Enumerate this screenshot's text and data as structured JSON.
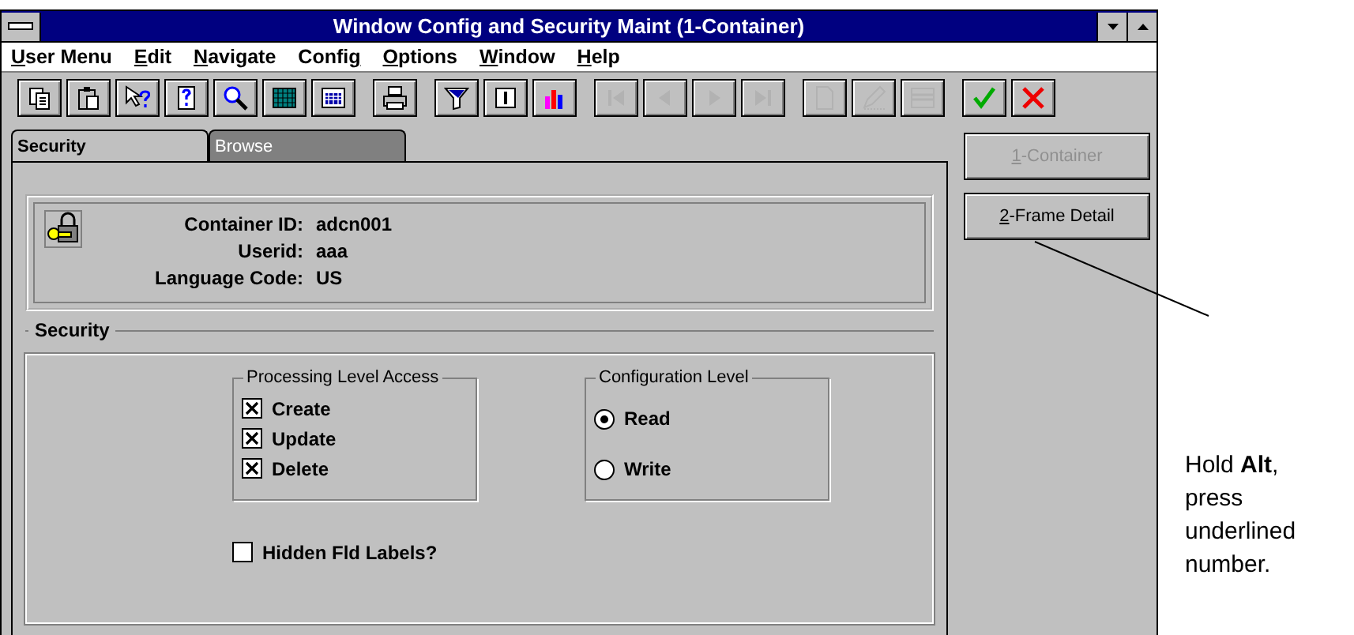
{
  "window": {
    "title": "Window Config and Security Maint (1-Container)"
  },
  "menu": [
    {
      "key": "U",
      "rest": "ser Menu"
    },
    {
      "key": "E",
      "rest": "dit"
    },
    {
      "key": "N",
      "rest": "avigate"
    },
    {
      "pre": "Confi",
      "key": "g"
    },
    {
      "key": "O",
      "rest": "ptions"
    },
    {
      "key": "W",
      "rest": "indow"
    },
    {
      "key": "H",
      "rest": "elp"
    }
  ],
  "toolbar": [
    [
      {
        "kind": "copy",
        "disabled": false
      },
      {
        "kind": "paste",
        "disabled": false
      },
      {
        "kind": "pointer-help",
        "disabled": false
      },
      {
        "kind": "help-book",
        "disabled": false
      },
      {
        "kind": "find",
        "disabled": false
      },
      {
        "kind": "grid",
        "disabled": false
      },
      {
        "kind": "calculator",
        "disabled": false
      }
    ],
    [
      {
        "kind": "print",
        "disabled": false
      }
    ],
    [
      {
        "kind": "filter",
        "disabled": false
      },
      {
        "kind": "text-cursor",
        "disabled": false
      },
      {
        "kind": "chart",
        "disabled": false
      }
    ],
    [
      {
        "kind": "first",
        "disabled": true
      },
      {
        "kind": "prev",
        "disabled": true
      },
      {
        "kind": "next",
        "disabled": true
      },
      {
        "kind": "last",
        "disabled": true
      }
    ],
    [
      {
        "kind": "new",
        "disabled": true
      },
      {
        "kind": "edit",
        "disabled": true
      },
      {
        "kind": "table",
        "disabled": true
      }
    ],
    [
      {
        "kind": "ok",
        "disabled": false
      },
      {
        "kind": "cancel",
        "disabled": false
      }
    ]
  ],
  "tabs": [
    {
      "label": "Security",
      "selected": true
    },
    {
      "label": "Browse",
      "selected": false
    }
  ],
  "info": [
    {
      "label": "Container ID:",
      "value": "adcn001"
    },
    {
      "label": "Userid:",
      "value": "aaa"
    },
    {
      "label": "Language Code:",
      "value": "US"
    }
  ],
  "security": {
    "title": "Security",
    "processing": {
      "title": "Processing Level Access",
      "items": [
        {
          "label": "Create",
          "checked": true
        },
        {
          "label": "Update",
          "checked": true
        },
        {
          "label": "Delete",
          "checked": true
        }
      ]
    },
    "configuration": {
      "title": "Configuration Level",
      "options": [
        {
          "label": "Read",
          "selected": true
        },
        {
          "label": "Write",
          "selected": false
        }
      ]
    },
    "hidden_labels": {
      "label": "Hidden Fld Labels?",
      "checked": false
    }
  },
  "side_buttons": [
    {
      "key": "1",
      "rest": "-Container",
      "disabled": true
    },
    {
      "key": "2",
      "rest": "-Frame Detail",
      "disabled": false
    }
  ],
  "annotation": "Hold **Alt**, press underlined number."
}
